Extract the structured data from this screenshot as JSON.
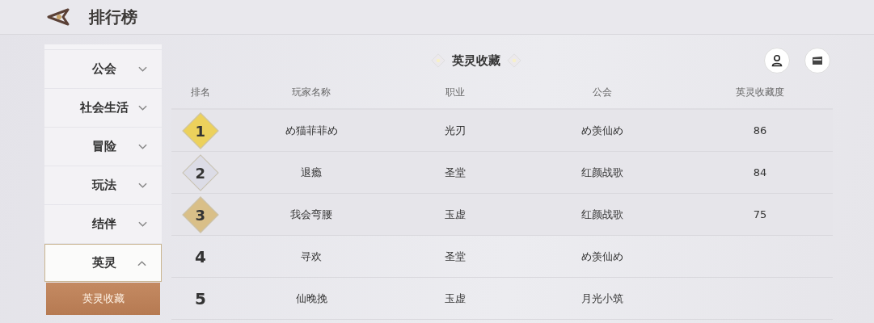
{
  "header": {
    "title": "排行榜"
  },
  "sidebar": {
    "items": [
      {
        "label": "公会",
        "expanded": false,
        "selected": false
      },
      {
        "label": "社会生活",
        "expanded": false,
        "selected": false
      },
      {
        "label": "冒险",
        "expanded": false,
        "selected": false
      },
      {
        "label": "玩法",
        "expanded": false,
        "selected": false
      },
      {
        "label": "结伴",
        "expanded": false,
        "selected": false
      },
      {
        "label": "英灵",
        "expanded": true,
        "selected": true,
        "children": [
          {
            "label": "英灵收藏",
            "selected": true
          }
        ]
      }
    ]
  },
  "section_title": "英灵收藏",
  "table": {
    "columns": [
      "排名",
      "玩家名称",
      "职业",
      "公会",
      "英灵收藏度"
    ],
    "rows": [
      {
        "rank": "1",
        "kind": "medal",
        "color": "#ecd15c",
        "name": "め猫菲菲め",
        "job": "光刃",
        "guild": "め羡仙め",
        "score": "86"
      },
      {
        "rank": "2",
        "kind": "medal",
        "color": "#dcdce6",
        "name": "退瘾",
        "job": "圣堂",
        "guild": "红颜战歌",
        "score": "84"
      },
      {
        "rank": "3",
        "kind": "medal",
        "color": "#d9bf88",
        "name": "我会弯腰",
        "job": "玉虚",
        "guild": "红颜战歌",
        "score": "75"
      },
      {
        "rank": "4",
        "kind": "plain",
        "name": "寻欢",
        "job": "圣堂",
        "guild": "め羡仙め"
      },
      {
        "rank": "5",
        "kind": "plain",
        "name": "仙晚挽",
        "job": "玉虚",
        "guild": "月光小筑"
      }
    ]
  }
}
